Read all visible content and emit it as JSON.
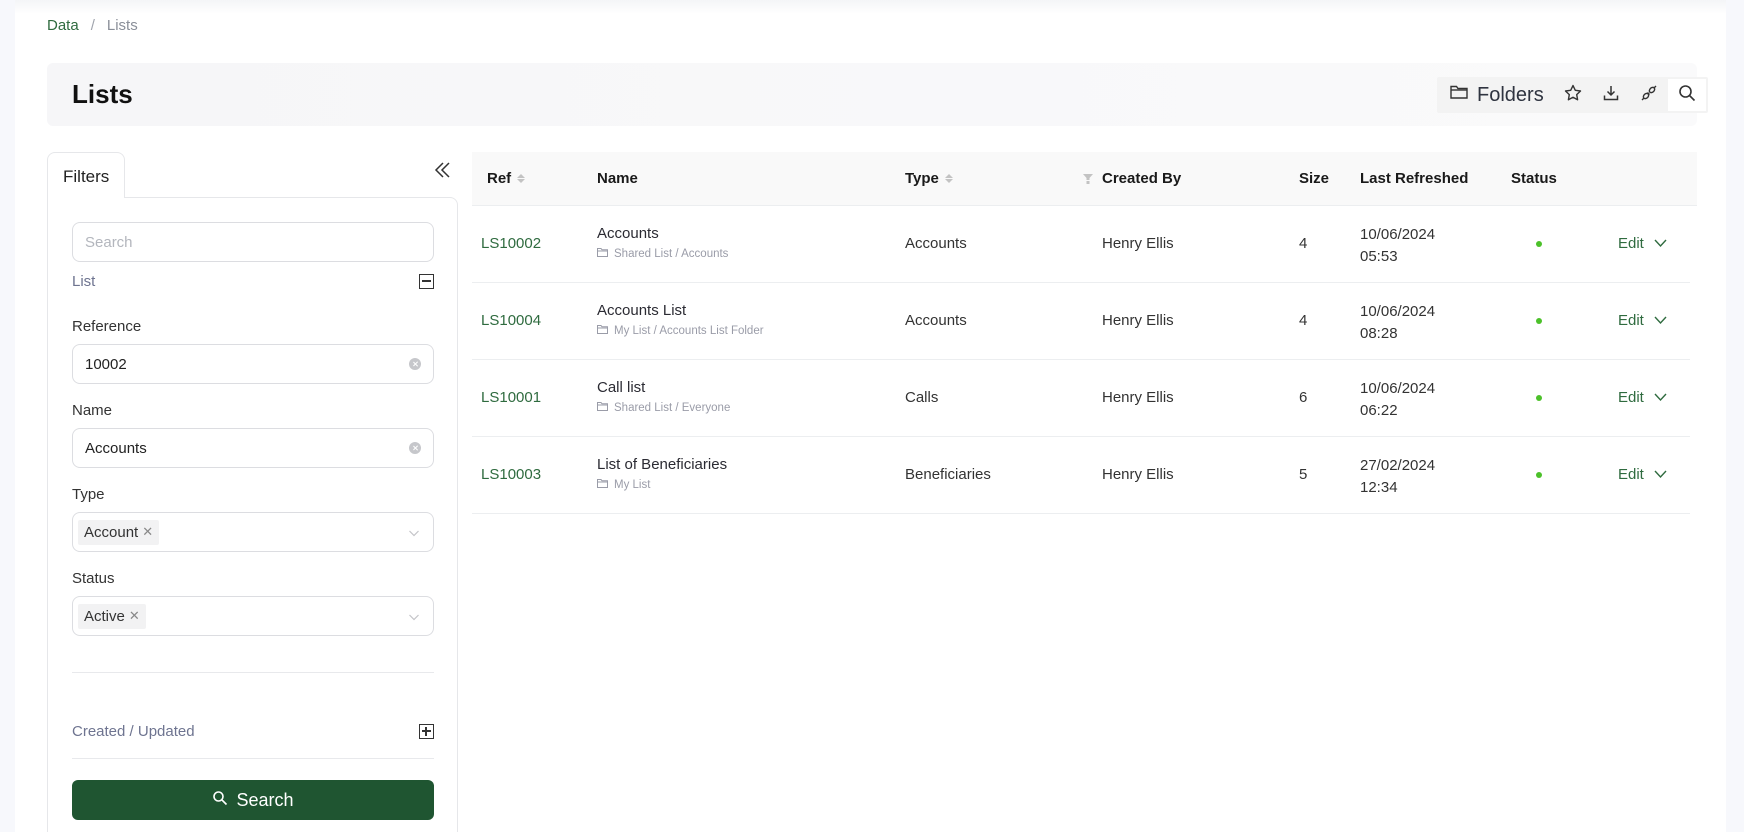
{
  "breadcrumb": [
    {
      "label": "Data",
      "link": true
    },
    {
      "label": "Lists",
      "link": false
    }
  ],
  "breadcrumb_separator": "/",
  "page": {
    "title": "Lists"
  },
  "toolbar": {
    "folders_label": "Folders",
    "icons": [
      "folder-icon",
      "star-icon",
      "download-icon",
      "plug-icon",
      "search-icon"
    ]
  },
  "filters": {
    "tab_label": "Filters",
    "search_placeholder": "Search",
    "list_section": {
      "title": "List",
      "expanded": true
    },
    "reference": {
      "label": "Reference",
      "value": "10002"
    },
    "name": {
      "label": "Name",
      "value": "Accounts"
    },
    "type": {
      "label": "Type",
      "selected": [
        "Account"
      ]
    },
    "status": {
      "label": "Status",
      "selected": [
        "Active"
      ]
    },
    "created_section": {
      "title": "Created / Updated",
      "expanded": false
    },
    "search_button": "Search"
  },
  "table": {
    "columns": {
      "ref": "Ref",
      "name": "Name",
      "type": "Type",
      "created_by": "Created By",
      "size": "Size",
      "last_refreshed": "Last Refreshed",
      "status": "Status"
    },
    "rows": [
      {
        "ref": "LS10002",
        "name": "Accounts",
        "path": "Shared List / Accounts",
        "type": "Accounts",
        "created_by": "Henry Ellis",
        "size": "4",
        "date": "10/06/2024",
        "time": "05:53",
        "status": "active",
        "action": "Edit"
      },
      {
        "ref": "LS10004",
        "name": "Accounts List",
        "path": "My List / Accounts List Folder",
        "type": "Accounts",
        "created_by": "Henry Ellis",
        "size": "4",
        "date": "10/06/2024",
        "time": "08:28",
        "status": "active",
        "action": "Edit"
      },
      {
        "ref": "LS10001",
        "name": "Call list",
        "path": "Shared List / Everyone",
        "type": "Calls",
        "created_by": "Henry Ellis",
        "size": "6",
        "date": "10/06/2024",
        "time": "06:22",
        "status": "active",
        "action": "Edit"
      },
      {
        "ref": "LS10003",
        "name": "List of Beneficiaries",
        "path": "My List",
        "type": "Beneficiaries",
        "created_by": "Henry Ellis",
        "size": "5",
        "date": "27/02/2024",
        "time": "12:34",
        "status": "active",
        "action": "Edit"
      }
    ]
  },
  "colors": {
    "brand_green": "#1f5531",
    "link_green": "#2f6b3f",
    "status_active": "#4cc12a"
  }
}
